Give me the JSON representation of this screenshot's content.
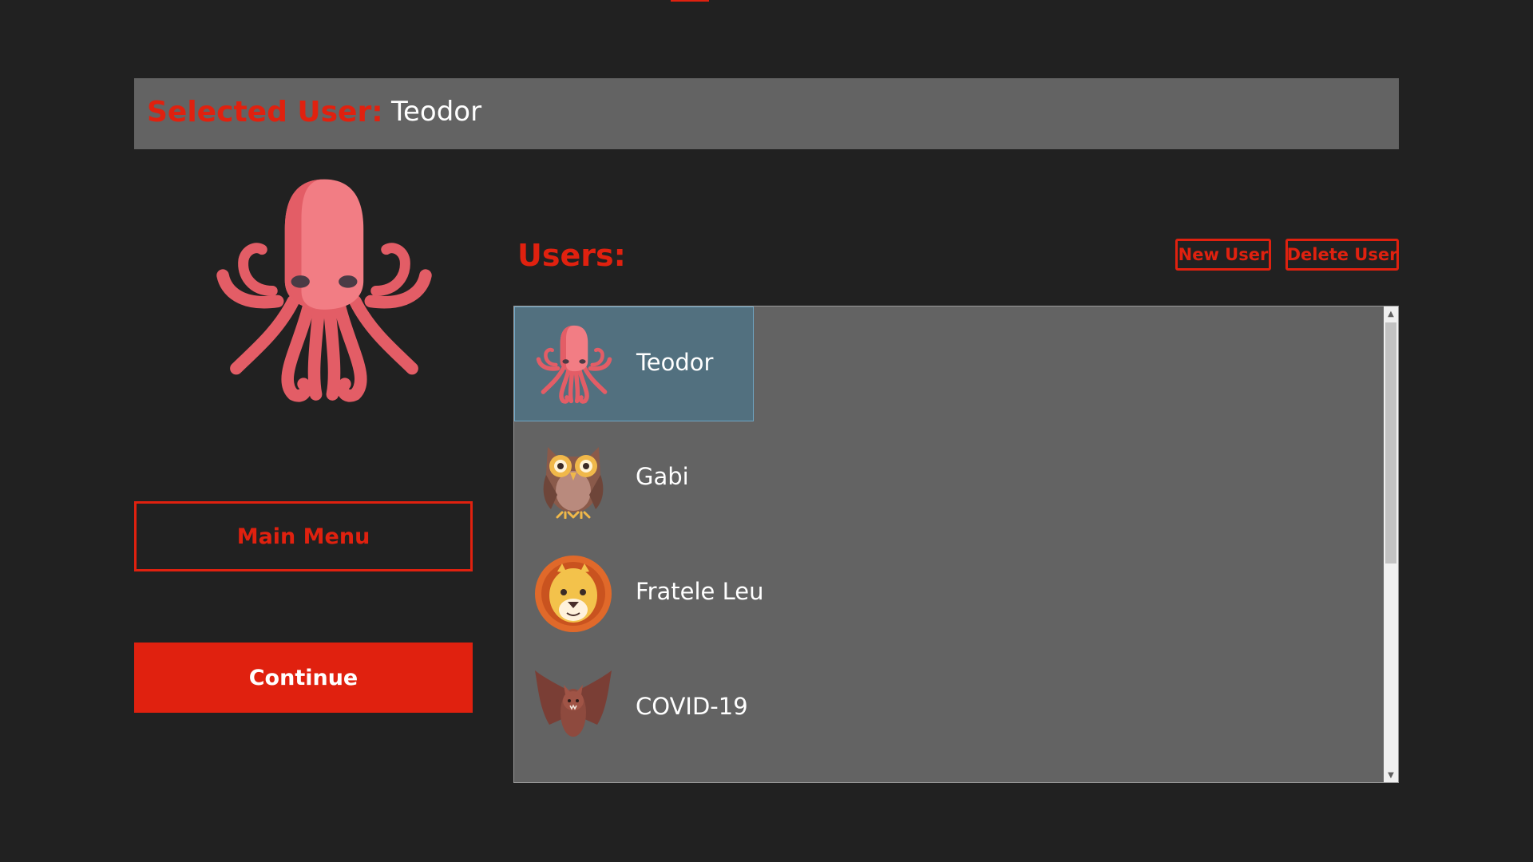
{
  "header": {
    "label": "Selected User:",
    "value": "Teodor"
  },
  "selected_avatar": "octopus-icon",
  "buttons": {
    "main_menu": "Main Menu",
    "continue": "Continue",
    "new_user": "New User",
    "delete_user": "Delete User"
  },
  "users_title": "Users:",
  "users": [
    {
      "name": "Teodor",
      "avatar": "octopus-icon",
      "selected": true
    },
    {
      "name": "Gabi",
      "avatar": "owl-icon",
      "selected": false
    },
    {
      "name": "Fratele Leu",
      "avatar": "lion-icon",
      "selected": false
    },
    {
      "name": "COVID-19",
      "avatar": "bat-icon",
      "selected": false
    }
  ],
  "scrollbar": {
    "up_icon": "chevron-up-icon",
    "down_icon": "chevron-down-icon"
  },
  "colors": {
    "background": "#212121",
    "panel": "#636363",
    "accent": "#e0210f",
    "selection": "#52707f",
    "selection_border": "#6fa7c6"
  }
}
